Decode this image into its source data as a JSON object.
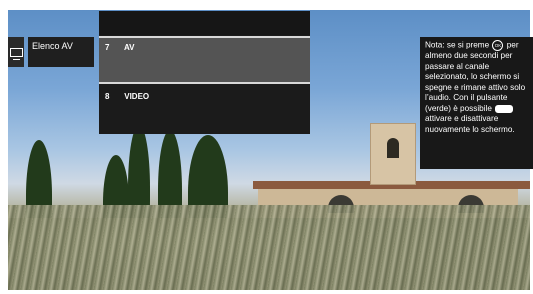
{
  "av_list": {
    "title": "Elenco AV",
    "items": [
      {
        "number": "7",
        "label": "AV",
        "selected": true
      },
      {
        "number": "8",
        "label": "VIDEO",
        "selected": false
      }
    ]
  },
  "note": {
    "part1": "Nota: se si preme",
    "ok_button": "OK",
    "part2": "per almeno due secondi per passare al canale selezionato, lo schermo si spegne e rimane attivo solo l’audio.",
    "part3": "Con il pulsante (verde) è possibile",
    "part4": "attivare e disattivare nuovamente lo schermo."
  },
  "icons": {
    "source": "tv-screen-icon",
    "ok": "ok-button-icon",
    "green": "green-button-icon"
  },
  "colors": {
    "panel": "#1b1b1b",
    "selected": "#545454",
    "highlight": "#d8d8d8"
  }
}
